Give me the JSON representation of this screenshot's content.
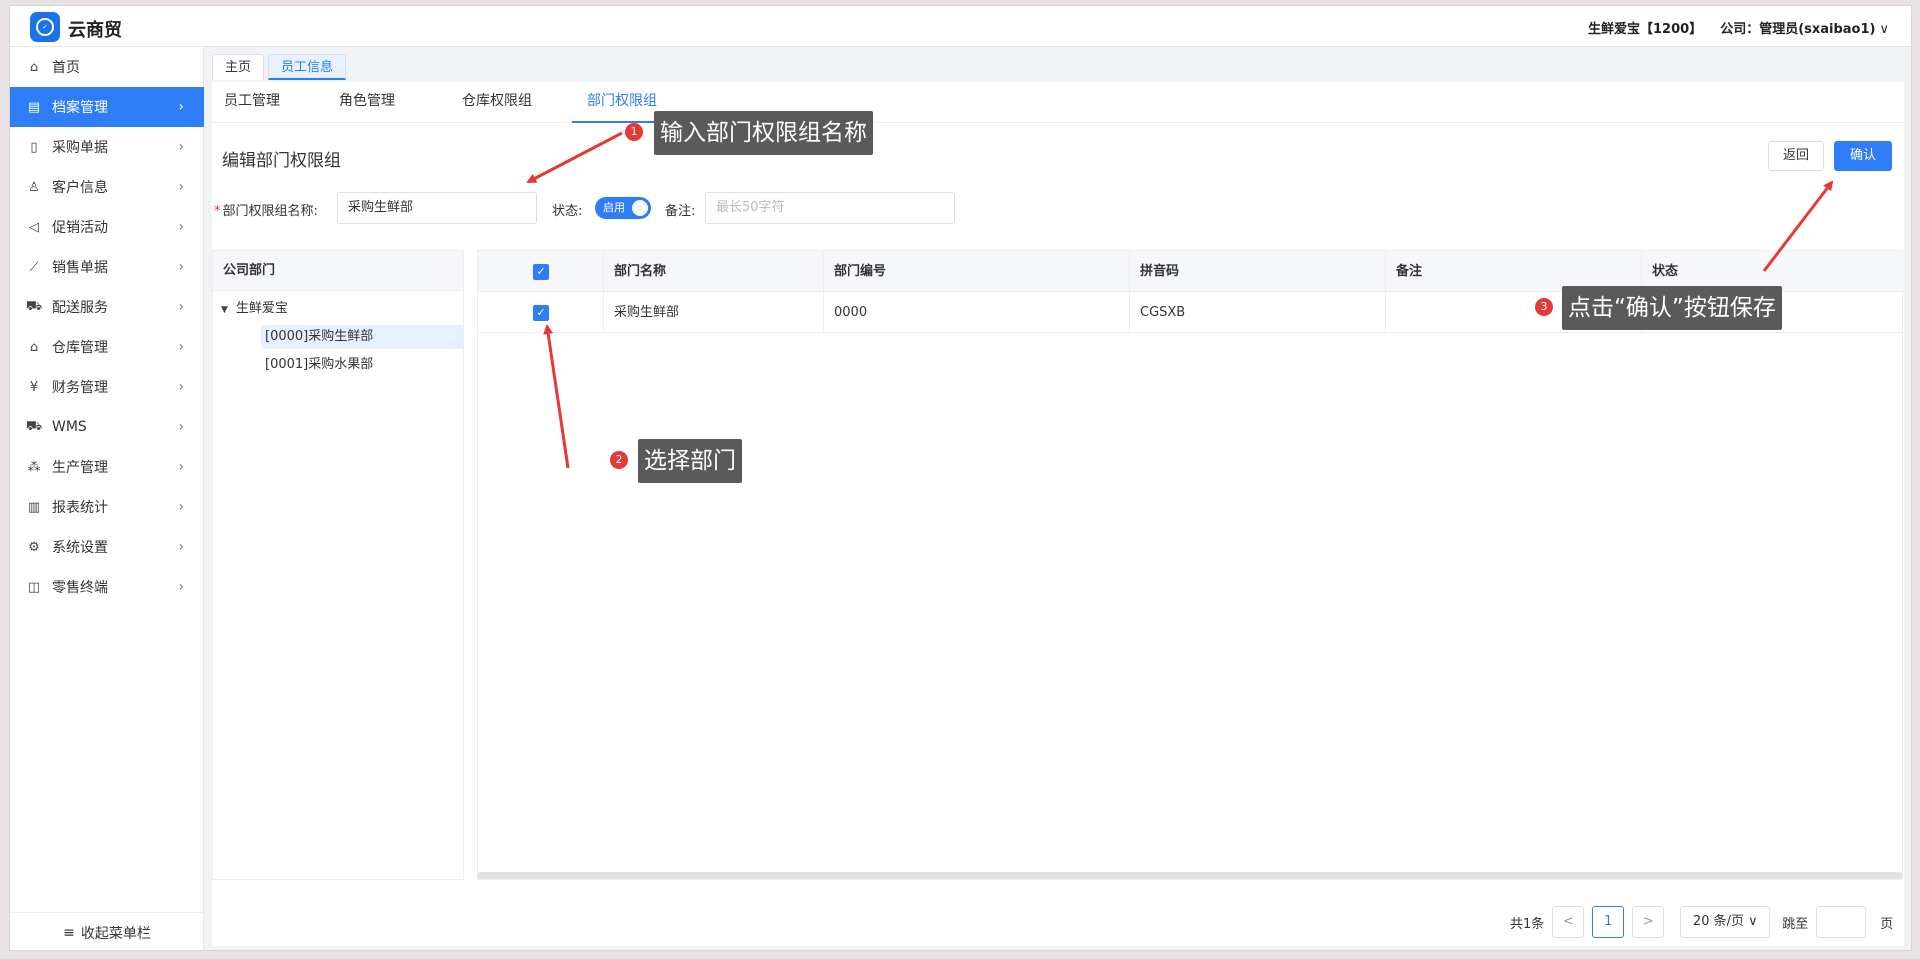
{
  "app": {
    "title": "云商贸"
  },
  "header": {
    "company": "生鲜爱宝【1200】",
    "user": "公司：管理员(sxaibao1)",
    "user_chevron": "∨"
  },
  "sidebar": {
    "items": [
      {
        "label": "首页",
        "icon": "home-icon",
        "glyph": "⌂"
      },
      {
        "label": "档案管理",
        "icon": "archive-icon",
        "glyph": "▤"
      },
      {
        "label": "采购单据",
        "icon": "document-icon",
        "glyph": "▯"
      },
      {
        "label": "客户信息",
        "icon": "user-icon",
        "glyph": "♙"
      },
      {
        "label": "促销活动",
        "icon": "megaphone-icon",
        "glyph": "◁"
      },
      {
        "label": "销售单据",
        "icon": "line-chart-icon",
        "glyph": "⟋"
      },
      {
        "label": "配送服务",
        "icon": "cart-icon",
        "glyph": "⛟"
      },
      {
        "label": "仓库管理",
        "icon": "warehouse-icon",
        "glyph": "⌂"
      },
      {
        "label": "财务管理",
        "icon": "yen-icon",
        "glyph": "¥"
      },
      {
        "label": "WMS",
        "icon": "truck-icon",
        "glyph": "⛟"
      },
      {
        "label": "生产管理",
        "icon": "network-icon",
        "glyph": "⁂"
      },
      {
        "label": "报表统计",
        "icon": "bar-chart-icon",
        "glyph": "▥"
      },
      {
        "label": "系统设置",
        "icon": "gear-icon",
        "glyph": "⚙"
      },
      {
        "label": "零售终端",
        "icon": "bag-icon",
        "glyph": "◫"
      }
    ],
    "collapse_label": "收起菜单栏",
    "collapse_glyph": "≡"
  },
  "page_tabs": [
    "主页",
    "员工信息"
  ],
  "sub_tabs": [
    "员工管理",
    "角色管理",
    "仓库权限组",
    "部门权限组"
  ],
  "page": {
    "heading": "编辑部门权限组",
    "back_label": "返回",
    "confirm_label": "确认"
  },
  "form": {
    "name_label": "部门权限组名称:",
    "name_value": "采购生鲜部",
    "status_label": "状态:",
    "status_value": "启用",
    "status_on": true,
    "remark_label": "备注:",
    "remark_placeholder": "最长50字符"
  },
  "tree": {
    "header": "公司部门",
    "root": "生鲜爱宝",
    "children": [
      "[0000]采购生鲜部",
      "[0001]采购水果部"
    ]
  },
  "table": {
    "columns": [
      "部门名称",
      "部门编号",
      "拼音码",
      "备注",
      "状态"
    ],
    "rows": [
      {
        "checked": true,
        "cells": [
          "采购生鲜部",
          "0000",
          "CGSXB",
          "",
          ""
        ]
      }
    ]
  },
  "pagination": {
    "total": "共1条",
    "prev": "<",
    "current": "1",
    "next": ">",
    "page_size": "20 条/页",
    "goto_label": "跳至",
    "page_unit": "页"
  },
  "annotations": [
    {
      "num": "1",
      "text": "输入部门权限组名称"
    },
    {
      "num": "2",
      "text": "选择部门"
    },
    {
      "num": "3",
      "text": "点击“确认”按钮保存"
    }
  ],
  "colors": {
    "accent": "#2e7cf6",
    "annotation_bg": "#5a5a5a",
    "annotation_red": "#e53935"
  }
}
